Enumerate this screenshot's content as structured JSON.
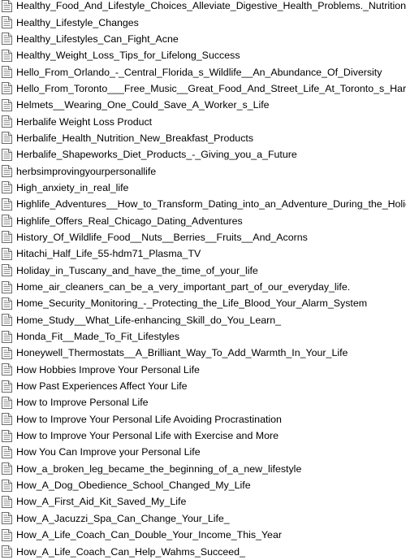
{
  "file_icon": "text-document-icon",
  "files": [
    "Healthy_Food_And_Lifestyle_Choices_Alleviate_Digestive_Health_Problems._Nutrition",
    "Healthy_Lifestyle_Changes",
    "Healthy_Lifestyles_Can_Fight_Acne",
    "Healthy_Weight_Loss_Tips_for_Lifelong_Success",
    "Hello_From_Orlando_-_Central_Florida_s_Wildlife__An_Abundance_Of_Diversity",
    "Hello_From_Toronto___Free_Music__Great_Food_And_Street_Life_At_Toronto_s_Har",
    "Helmets__Wearing_One_Could_Save_A_Worker_s_Life",
    "Herbalife Weight Loss Product",
    "Herbalife_Health_Nutrition_New_Breakfast_Products",
    "Herbalife_Shapeworks_Diet_Products_-_Giving_you_a_Future",
    "herbsimprovingyourpersonallife",
    "High_anxiety_in_real_life",
    "Highlife_Adventures__How_to_Transform_Dating_into_an_Adventure_During_the_Holida",
    "Highlife_Offers_Real_Chicago_Dating_Adventures",
    "History_Of_Wildlife_Food__Nuts__Berries__Fruits__And_Acorns",
    "Hitachi_Half_Life_55-hdm71_Plasma_TV",
    "Holiday_in_Tuscany_and_have_the_time_of_your_life",
    "Home_air_cleaners_can_be_a_very_important_part_of_our_everyday_life.",
    "Home_Security_Monitoring_-_Protecting_the_Life_Blood_Your_Alarm_System",
    "Home_Study__What_Life-enhancing_Skill_do_You_Learn_",
    "Honda_Fit__Made_To_Fit_Lifestyles",
    "Honeywell_Thermostats__A_Brilliant_Way_To_Add_Warmth_In_Your_Life",
    "How Hobbies Improve Your Personal Life",
    "How Past Experiences Affect Your Life",
    "How to Improve Personal Life",
    "How to Improve Your Personal Life Avoiding Procrastination",
    "How to Improve Your Personal Life with Exercise and More",
    "How You Can Improve your Personal Life",
    "How_a_broken_leg_became_the_beginning_of_a_new_lifestyle",
    "How_A_Dog_Obedience_School_Changed_My_Life",
    "How_A_First_Aid_Kit_Saved_My_Life",
    "How_A_Jacuzzi_Spa_Can_Change_Your_Life_",
    "How_A_Life_Coach_Can_Double_Your_Income_This_Year",
    "How_A_Life_Coach_Can_Help_Wahms_Succeed_"
  ]
}
